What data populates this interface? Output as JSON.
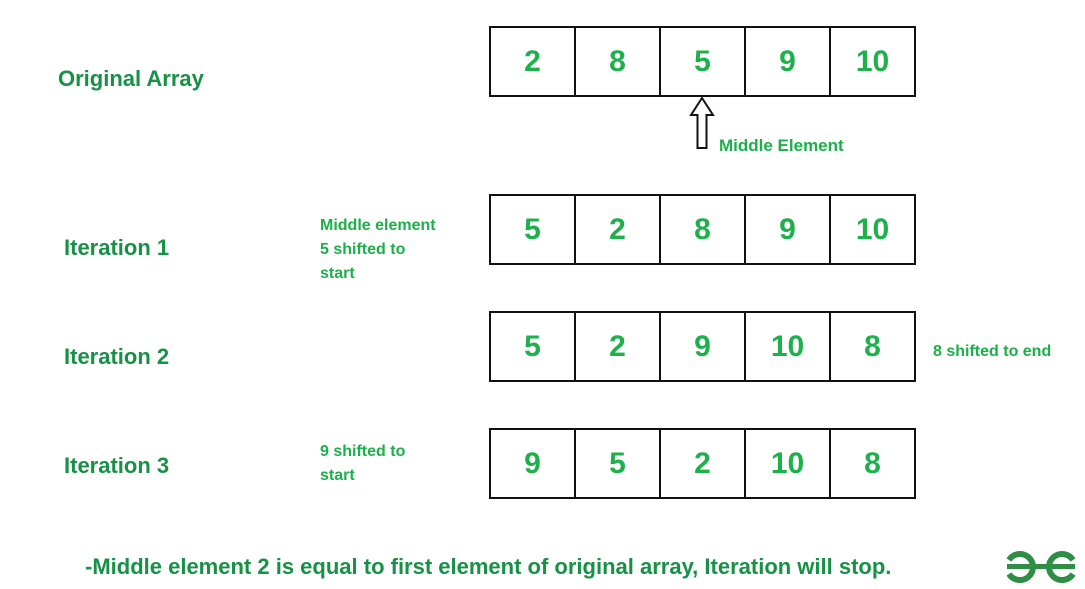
{
  "rows": [
    {
      "label": "Original Array",
      "values": [
        "2",
        "8",
        "5",
        "9",
        "10"
      ]
    },
    {
      "label": "Iteration 1",
      "values": [
        "5",
        "2",
        "8",
        "9",
        "10"
      ]
    },
    {
      "label": "Iteration 2",
      "values": [
        "5",
        "2",
        "9",
        "10",
        "8"
      ]
    },
    {
      "label": "Iteration 3",
      "values": [
        "9",
        "5",
        "2",
        "10",
        "8"
      ]
    }
  ],
  "annotations": {
    "middle_element": "Middle Element",
    "iter1_line1": "Middle element",
    "iter1_line2": "5 shifted to",
    "iter1_line3": "start",
    "iter2": "8 shifted to end",
    "iter3_line1": "9 shifted to",
    "iter3_line2": "start"
  },
  "footer": "-Middle element  2 is equal to first element of original array, Iteration will stop.",
  "logo": "geeksforgeeks-logo-icon",
  "colors": {
    "green": "#1db14b",
    "dark_green": "#169146",
    "border": "#111111"
  }
}
